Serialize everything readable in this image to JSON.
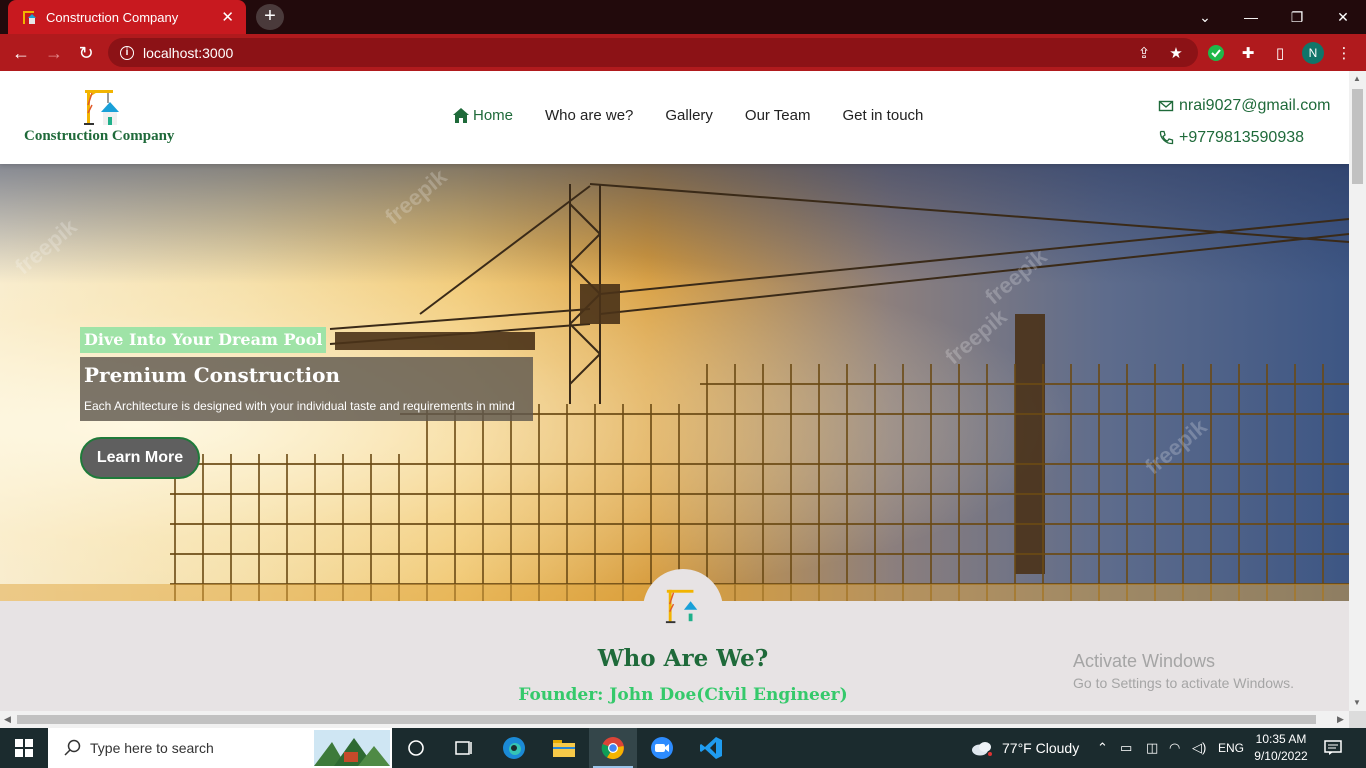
{
  "browser": {
    "tab_title": "Construction Company",
    "url": "localhost:3000",
    "profile_initial": "N"
  },
  "site": {
    "brand": "Construction Company",
    "nav": [
      "Home",
      "Who are we?",
      "Gallery",
      "Our Team",
      "Get in touch"
    ],
    "email": "nrai9027@gmail.com",
    "phone": "+9779813590938"
  },
  "hero": {
    "tag": "Dive Into Your Dream Pool",
    "title": "Premium Construction",
    "subtitle": "Each Architecture is designed with your individual taste and requirements in mind",
    "button": "Learn More",
    "watermark": "freepik"
  },
  "about": {
    "title": "Who Are We?",
    "founder": "Founder: John Doe(Civil Engineer)"
  },
  "windows_notice": {
    "line1": "Activate Windows",
    "line2": "Go to Settings to activate Windows."
  },
  "taskbar": {
    "search_placeholder": "Type here to search",
    "weather": "77°F  Cloudy",
    "language": "ENG",
    "time": "10:35 AM",
    "date": "9/10/2022"
  },
  "colors": {
    "brand_green": "#1f6a3a",
    "founder_green": "#35c96b",
    "browser_red": "#b01a1d",
    "tag_green": "#9fe3a7"
  }
}
